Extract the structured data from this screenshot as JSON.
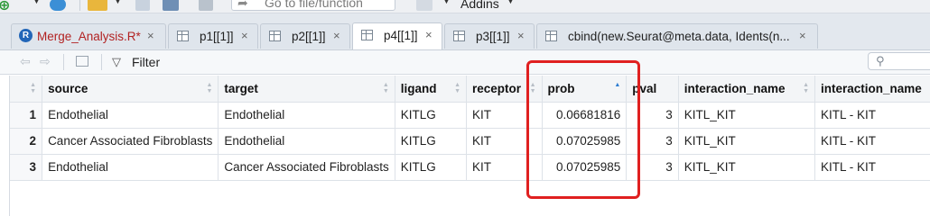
{
  "toolbar": {
    "goto_placeholder": "Go to file/function",
    "addins_label": "Addins",
    "colors": {
      "new_file": "#2e9a3a",
      "open": "#e9b63c",
      "save": "#6f8fb5"
    }
  },
  "tabs": [
    {
      "label": "Merge_Analysis.R*",
      "icon": "r-file-icon",
      "logo_letter": "R",
      "active": false
    },
    {
      "label": "p1[[1]]",
      "icon": "table-icon",
      "active": false
    },
    {
      "label": "p2[[1]]",
      "icon": "table-icon",
      "active": false
    },
    {
      "label": "p4[[1]]",
      "icon": "table-icon",
      "active": true
    },
    {
      "label": "p3[[1]]",
      "icon": "table-icon",
      "active": false
    },
    {
      "label": "cbind(new.Seurat@meta.data, Idents(n...",
      "icon": "table-icon",
      "active": false
    }
  ],
  "tab_close_glyph": "×",
  "filter": {
    "label": "Filter"
  },
  "table": {
    "columns": [
      "source",
      "target",
      "ligand",
      "receptor",
      "prob",
      "pval",
      "interaction_name",
      "interaction_name"
    ],
    "sorted_column": "prob",
    "rows": [
      {
        "n": "1",
        "cells": [
          "Endothelial",
          "Endothelial",
          "KITLG",
          "KIT",
          "0.06681816",
          "3",
          "KITL_KIT",
          "KITL - KIT"
        ]
      },
      {
        "n": "2",
        "cells": [
          "Cancer Associated Fibroblasts",
          "Endothelial",
          "KITLG",
          "KIT",
          "0.07025985",
          "3",
          "KITL_KIT",
          "KITL - KIT"
        ]
      },
      {
        "n": "3",
        "cells": [
          "Endothelial",
          "Cancer Associated Fibroblasts",
          "KITLG",
          "KIT",
          "0.07025985",
          "3",
          "KITL_KIT",
          "KITL - KIT"
        ]
      }
    ]
  },
  "highlight_color": "#e02020"
}
